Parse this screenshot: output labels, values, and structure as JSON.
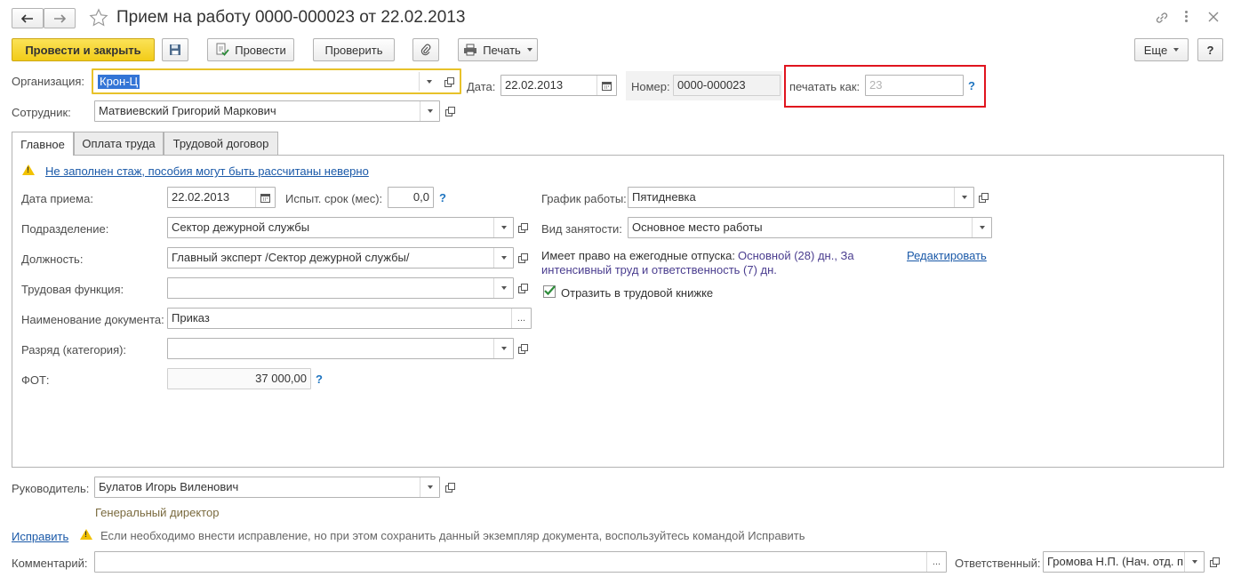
{
  "window": {
    "title": "Прием на работу 0000-000023 от 22.02.2013"
  },
  "toolbar": {
    "post_close": "Провести и закрыть",
    "post": "Провести",
    "check": "Проверить",
    "print": "Печать",
    "more": "Еще",
    "help": "?"
  },
  "header": {
    "org_label": "Организация:",
    "org_value": "Крон-Ц",
    "date_label": "Дата:",
    "date_value": "22.02.2013",
    "number_label": "Номер:",
    "number_value": "0000-000023",
    "print_as_label": "печатать как:",
    "print_as_placeholder": "23",
    "employee_label": "Сотрудник:",
    "employee_value": "Матвиевский Григорий Маркович"
  },
  "tabs": [
    {
      "label": "Главное"
    },
    {
      "label": "Оплата труда"
    },
    {
      "label": "Трудовой договор"
    }
  ],
  "main": {
    "warning_link": "Не заполнен стаж, пособия могут быть рассчитаны неверно",
    "hire_date_label": "Дата приема:",
    "hire_date_value": "22.02.2013",
    "probation_label": "Испыт. срок (мес):",
    "probation_value": "0,0",
    "department_label": "Подразделение:",
    "department_value": "Сектор дежурной службы",
    "position_label": "Должность:",
    "position_value": "Главный эксперт /Сектор дежурной службы/",
    "labor_function_label": "Трудовая функция:",
    "labor_function_value": "",
    "doc_name_label": "Наименование документа:",
    "doc_name_value": "Приказ",
    "grade_label": "Разряд (категория):",
    "grade_value": "",
    "fot_label": "ФОТ:",
    "fot_value": "37 000,00",
    "schedule_label": "График работы:",
    "schedule_value": "Пятидневка",
    "employment_label": "Вид занятости:",
    "employment_value": "Основное место работы",
    "vacation_label": "Имеет право на ежегодные отпуска:",
    "vacation_value_1": "Основной (28) дн., За",
    "vacation_value_2": "интенсивный труд и ответственность (7) дн.",
    "edit_link": "Редактировать",
    "workbook_label": "Отразить в трудовой книжке"
  },
  "footer": {
    "manager_label": "Руководитель:",
    "manager_value": "Булатов Игорь Виленович",
    "manager_position": "Генеральный директор",
    "fix_link": "Исправить",
    "fix_note": "Если необходимо внести исправление, но при этом сохранить данный экземпляр документа, воспользуйтесь командой Исправить",
    "comment_label": "Комментарий:",
    "comment_value": "",
    "responsible_label": "Ответственный:",
    "responsible_value": "Громова Н.П. (Нач. отд. п"
  },
  "colors": {
    "primary_button": "#f7d421",
    "highlight_frame": "#e0141e",
    "link": "#1a59a8",
    "vacation_text": "#4a3d8f",
    "manager_position": "#7a6a3e",
    "focus_border": "#e8c22a",
    "checkbox": "#2d8c3a"
  }
}
